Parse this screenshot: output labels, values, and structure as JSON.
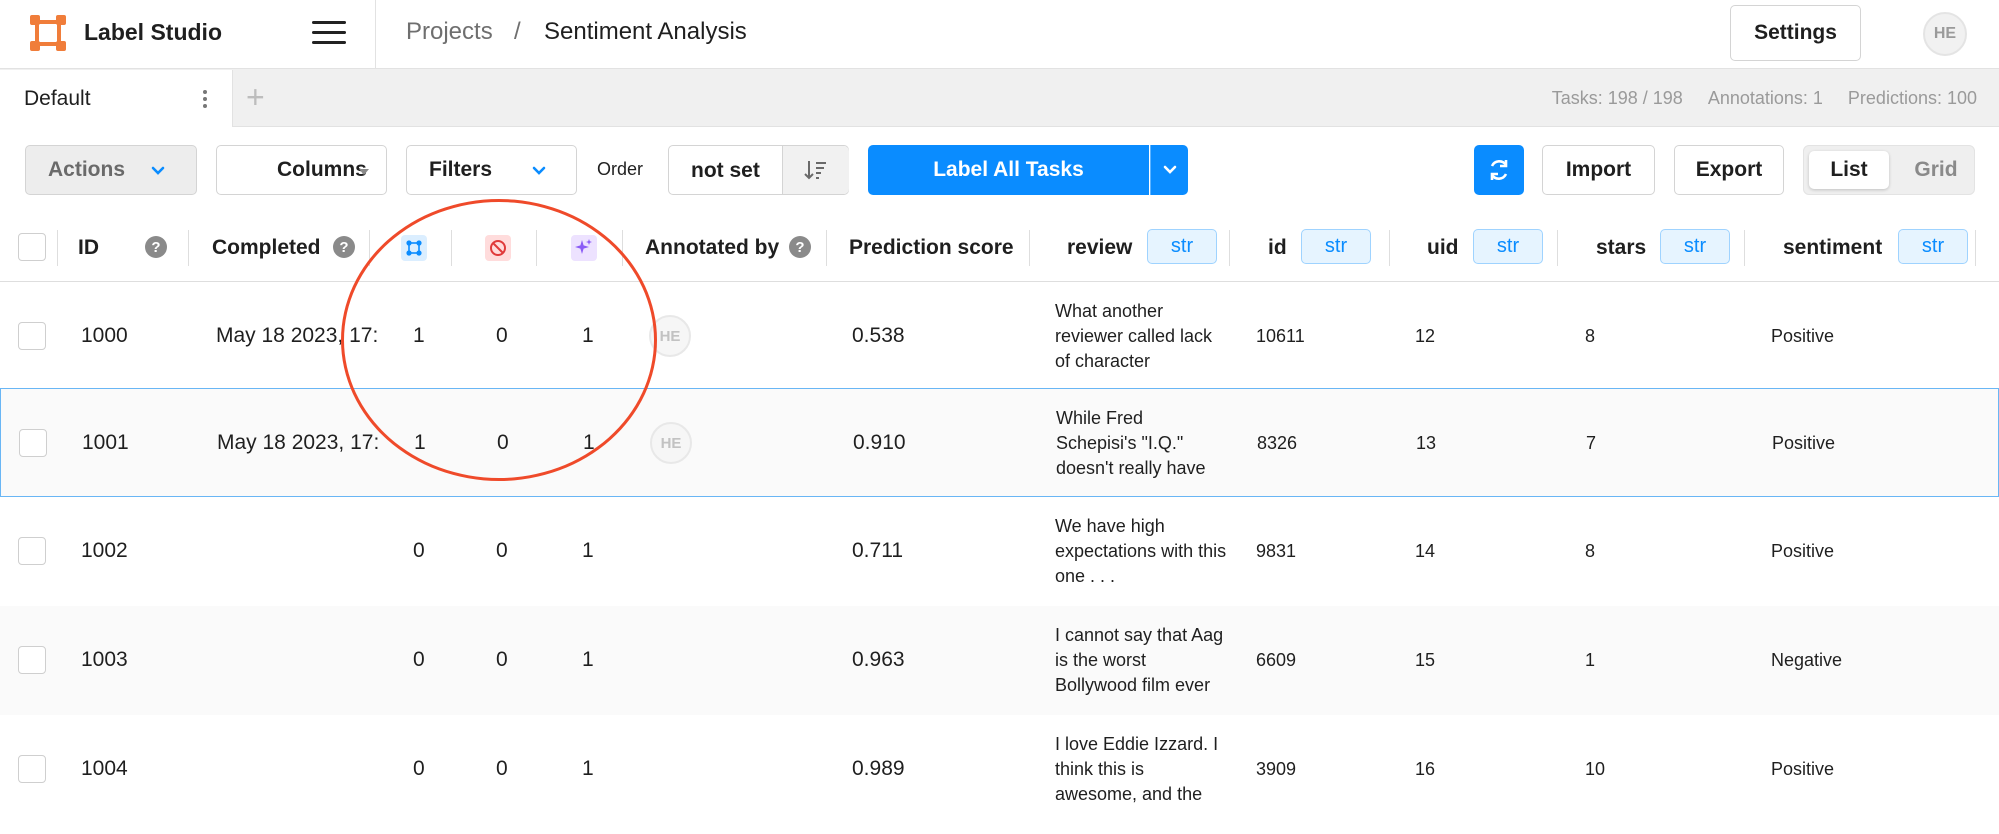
{
  "app": {
    "title": "Label Studio"
  },
  "breadcrumb": {
    "projects": "Projects",
    "separator": "/",
    "current": "Sentiment Analysis"
  },
  "header": {
    "settings_label": "Settings",
    "avatar_initials": "HE"
  },
  "tabs": {
    "items": [
      {
        "label": "Default"
      }
    ],
    "add_label": "+"
  },
  "stats": {
    "tasks": "Tasks: 198 / 198",
    "annotations": "Annotations: 1",
    "predictions": "Predictions: 100"
  },
  "toolbar": {
    "actions_label": "Actions",
    "columns_label": "Columns",
    "filters_label": "Filters",
    "order_label": "Order",
    "order_value": "not set",
    "label_all_label": "Label All Tasks",
    "import_label": "Import",
    "export_label": "Export",
    "view_list_label": "List",
    "view_grid_label": "Grid"
  },
  "table": {
    "headers": {
      "id": "ID",
      "completed": "Completed",
      "annotated_by": "Annotated by",
      "prediction_score": "Prediction score",
      "review": "review",
      "id_col": "id",
      "uid": "uid",
      "stars": "stars",
      "sentiment": "sentiment",
      "type_badge": "str",
      "help": "?"
    },
    "header_icons": [
      "annotations-count-icon",
      "cancelled-count-icon",
      "predictions-count-icon"
    ],
    "rows": [
      {
        "id": "1000",
        "completed": "May 18 2023, 17:",
        "annotations": "1",
        "cancelled": "0",
        "predictions": "1",
        "annotator": "HE",
        "score": "0.538",
        "review": "What another reviewer called lack of character",
        "data_id": "10611",
        "uid": "12",
        "stars": "8",
        "sentiment": "Positive"
      },
      {
        "id": "1001",
        "completed": "May 18 2023, 17:",
        "annotations": "1",
        "cancelled": "0",
        "predictions": "1",
        "annotator": "HE",
        "score": "0.910",
        "review": "While Fred Schepisi's \"I.Q.\" doesn't really have",
        "data_id": "8326",
        "uid": "13",
        "stars": "7",
        "sentiment": "Positive"
      },
      {
        "id": "1002",
        "completed": "",
        "annotations": "0",
        "cancelled": "0",
        "predictions": "1",
        "annotator": "",
        "score": "0.711",
        "review": "We have high expectations with this one . . .",
        "data_id": "9831",
        "uid": "14",
        "stars": "8",
        "sentiment": "Positive"
      },
      {
        "id": "1003",
        "completed": "",
        "annotations": "0",
        "cancelled": "0",
        "predictions": "1",
        "annotator": "",
        "score": "0.963",
        "review": "I cannot say that Aag is the worst Bollywood film ever",
        "data_id": "6609",
        "uid": "15",
        "stars": "1",
        "sentiment": "Negative"
      },
      {
        "id": "1004",
        "completed": "",
        "annotations": "0",
        "cancelled": "0",
        "predictions": "1",
        "annotator": "",
        "score": "0.989",
        "review": "I love Eddie Izzard. I think this is awesome, and the",
        "data_id": "3909",
        "uid": "16",
        "stars": "10",
        "sentiment": "Positive"
      }
    ]
  },
  "colors": {
    "accent": "#0a8cff",
    "brand": "#f07d3a",
    "highlight_circle": "#ef4a2a"
  }
}
